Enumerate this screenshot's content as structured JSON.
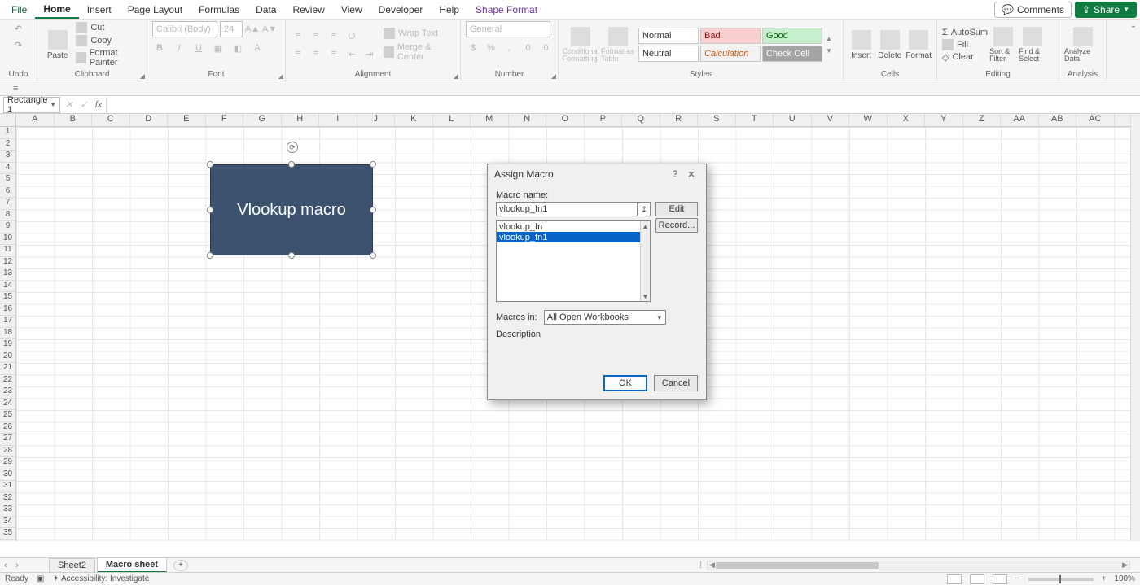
{
  "menu": {
    "file": "File",
    "home": "Home",
    "insert": "Insert",
    "page_layout": "Page Layout",
    "formulas": "Formulas",
    "data": "Data",
    "review": "Review",
    "view": "View",
    "developer": "Developer",
    "help": "Help",
    "shape_format": "Shape Format",
    "comments": "Comments",
    "share": "Share"
  },
  "ribbon": {
    "undo_group": "Undo",
    "clipboard": {
      "paste": "Paste",
      "cut": "Cut",
      "copy": "Copy",
      "format_painter": "Format Painter",
      "label": "Clipboard"
    },
    "font": {
      "name": "Calibri (Body)",
      "size": "24",
      "label": "Font"
    },
    "alignment": {
      "wrap": "Wrap Text",
      "merge": "Merge & Center",
      "label": "Alignment"
    },
    "number": {
      "format": "General",
      "label": "Number"
    },
    "styles": {
      "cond": "Conditional Formatting",
      "table": "Format as Table",
      "normal": "Normal",
      "bad": "Bad",
      "good": "Good",
      "neutral": "Neutral",
      "calculation": "Calculation",
      "check_cell": "Check Cell",
      "label": "Styles"
    },
    "cells": {
      "insert": "Insert",
      "delete": "Delete",
      "format": "Format",
      "label": "Cells"
    },
    "editing": {
      "autosum": "AutoSum",
      "fill": "Fill",
      "clear": "Clear",
      "sort": "Sort & Filter",
      "find": "Find & Select",
      "label": "Editing"
    },
    "analysis": {
      "analyze": "Analyze Data",
      "label": "Analysis"
    }
  },
  "name_box": "Rectangle 1",
  "columns": [
    "A",
    "B",
    "C",
    "D",
    "E",
    "F",
    "G",
    "H",
    "I",
    "J",
    "K",
    "L",
    "M",
    "N",
    "O",
    "P",
    "Q",
    "R",
    "S",
    "T",
    "U",
    "V",
    "W",
    "X",
    "Y",
    "Z",
    "AA",
    "AB",
    "AC"
  ],
  "row_count": 35,
  "shape": {
    "text": "Vlookup macro"
  },
  "dialog": {
    "title": "Assign Macro",
    "macro_name_label": "Macro name:",
    "macro_name_value": "vlookup_fn1",
    "list": [
      "vlookup_fn",
      "vlookup_fn1"
    ],
    "selected_index": 1,
    "macros_in_label": "Macros in:",
    "macros_in_value": "All Open Workbooks",
    "description_label": "Description",
    "edit": "Edit",
    "record": "Record...",
    "ok": "OK",
    "cancel": "Cancel"
  },
  "sheets": {
    "prev": "‹",
    "next": "›",
    "sheet2": "Sheet2",
    "macro_sheet": "Macro sheet"
  },
  "status": {
    "ready": "Ready",
    "accessibility": "Accessibility: Investigate",
    "zoom": "100%"
  }
}
